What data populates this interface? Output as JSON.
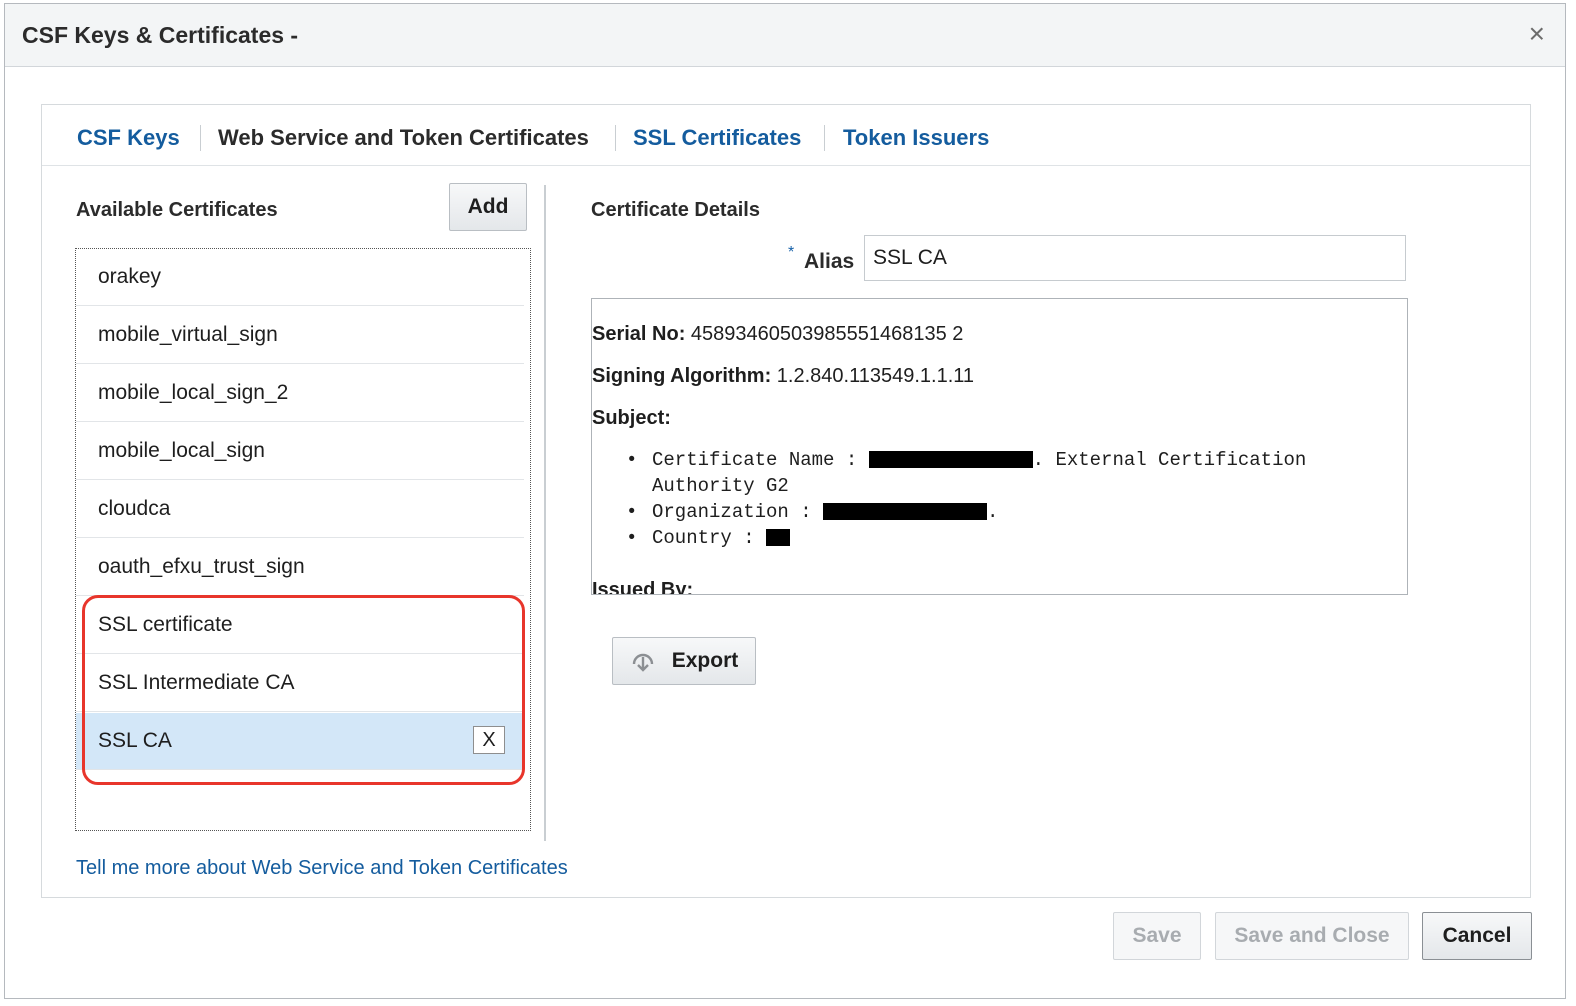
{
  "window": {
    "title": "CSF Keys & Certificates -",
    "close_glyph": "×"
  },
  "tabs": [
    {
      "label": "CSF Keys",
      "active": false
    },
    {
      "label": "Web Service and Token Certificates",
      "active": true
    },
    {
      "label": "SSL Certificates",
      "active": false
    },
    {
      "label": "Token Issuers",
      "active": false
    }
  ],
  "left": {
    "title": "Available Certificates",
    "add_label": "Add",
    "certificates": [
      {
        "label": "orakey"
      },
      {
        "label": "mobile_virtual_sign"
      },
      {
        "label": "mobile_local_sign_2"
      },
      {
        "label": "mobile_local_sign"
      },
      {
        "label": "cloudca"
      },
      {
        "label": "oauth_efxu_trust_sign"
      },
      {
        "label": "SSL certificate"
      },
      {
        "label": "SSL Intermediate CA"
      },
      {
        "label": "SSL CA",
        "selected": true
      }
    ],
    "delete_label": "X"
  },
  "details": {
    "title": "Certificate Details",
    "required_mark": "*",
    "alias_label": "Alias",
    "alias_value": "SSL CA",
    "serial_label": "Serial No:",
    "serial_value": "45893460503985551468135 2",
    "signing_label": "Signing Algorithm:",
    "signing_value": "1.2.840.113549.1.1.11",
    "subject_label": "Subject:",
    "subject_items": {
      "cert_name_prefix": "Certificate Name : ",
      "cert_name_suffix": ". External Certification",
      "cert_name_line2": "Authority G2",
      "org_prefix": "Organization : ",
      "org_suffix": ".",
      "country_prefix": "Country : "
    },
    "issued_by_label": "Issued By:",
    "export_label": "Export"
  },
  "help_link": "Tell me more about Web Service and Token Certificates",
  "footer": {
    "save_label": "Save",
    "save_close_label": "Save and Close",
    "cancel_label": "Cancel"
  },
  "colors": {
    "link": "#145c9e",
    "selected_row": "#d3e7f8",
    "highlight": "#e8352b"
  }
}
